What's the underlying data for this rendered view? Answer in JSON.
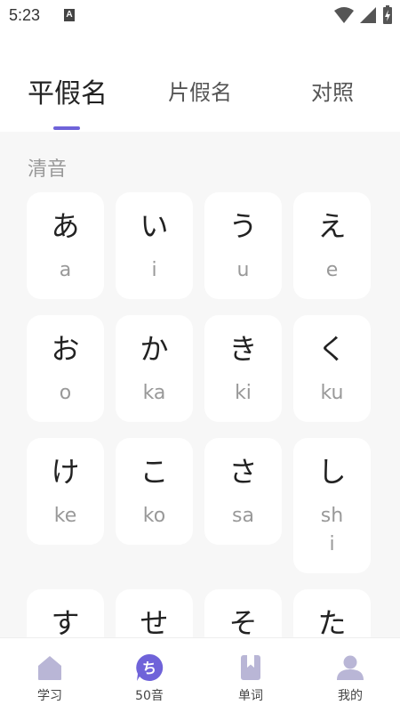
{
  "status_bar": {
    "time": "5:23",
    "notification": "A"
  },
  "tabs": [
    {
      "label": "平假名",
      "active": true
    },
    {
      "label": "片假名",
      "active": false
    },
    {
      "label": "对照",
      "active": false
    }
  ],
  "section": {
    "title": "清音"
  },
  "cards": [
    {
      "kana": "あ",
      "romaji": "a"
    },
    {
      "kana": "い",
      "romaji": "i"
    },
    {
      "kana": "う",
      "romaji": "u"
    },
    {
      "kana": "え",
      "romaji": "e"
    },
    {
      "kana": "お",
      "romaji": "o"
    },
    {
      "kana": "か",
      "romaji": "ka"
    },
    {
      "kana": "き",
      "romaji": "ki"
    },
    {
      "kana": "く",
      "romaji": "ku"
    },
    {
      "kana": "け",
      "romaji": "ke"
    },
    {
      "kana": "こ",
      "romaji": "ko"
    },
    {
      "kana": "さ",
      "romaji": "sa"
    },
    {
      "kana": "し",
      "romaji": "shi"
    },
    {
      "kana": "す",
      "romaji": ""
    },
    {
      "kana": "せ",
      "romaji": ""
    },
    {
      "kana": "そ",
      "romaji": ""
    },
    {
      "kana": "た",
      "romaji": ""
    }
  ],
  "bottom_nav": {
    "items": [
      {
        "label": "学习",
        "icon": "home-icon"
      },
      {
        "label": "50音",
        "icon": "kana-chi-icon",
        "icon_text": "ち",
        "active": true
      },
      {
        "label": "单词",
        "icon": "book-icon"
      },
      {
        "label": "我的",
        "icon": "profile-icon"
      }
    ]
  },
  "colors": {
    "accent": "#6f63d9",
    "icon_gray": "#b9b6d6",
    "background": "#f7f7f7"
  }
}
